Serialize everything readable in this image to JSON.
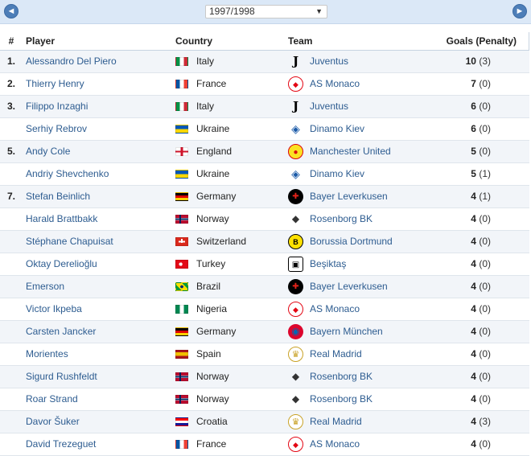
{
  "header": {
    "season": "1997/1998",
    "prev_glyph": "◄",
    "next_glyph": "►",
    "dropdown_glyph": "▼"
  },
  "columns": {
    "rank": "#",
    "player": "Player",
    "country": "Country",
    "team": "Team",
    "goals": "Goals (Penalty)"
  },
  "rows": [
    {
      "rank": "1.",
      "player": "Alessandro Del Piero",
      "country": "Italy",
      "flag": "italy",
      "team": "Juventus",
      "crest": "juventus",
      "goals": "10",
      "penalty": "(3)"
    },
    {
      "rank": "2.",
      "player": "Thierry Henry",
      "country": "France",
      "flag": "france",
      "team": "AS Monaco",
      "crest": "monaco",
      "goals": "7",
      "penalty": "(0)"
    },
    {
      "rank": "3.",
      "player": "Filippo Inzaghi",
      "country": "Italy",
      "flag": "italy",
      "team": "Juventus",
      "crest": "juventus",
      "goals": "6",
      "penalty": "(0)"
    },
    {
      "rank": "",
      "player": "Serhiy Rebrov",
      "country": "Ukraine",
      "flag": "ukraine",
      "team": "Dinamo Kiev",
      "crest": "dinamo",
      "goals": "6",
      "penalty": "(0)"
    },
    {
      "rank": "5.",
      "player": "Andy Cole",
      "country": "England",
      "flag": "england",
      "team": "Manchester United",
      "crest": "manutd",
      "goals": "5",
      "penalty": "(0)"
    },
    {
      "rank": "",
      "player": "Andriy Shevchenko",
      "country": "Ukraine",
      "flag": "ukraine",
      "team": "Dinamo Kiev",
      "crest": "dinamo",
      "goals": "5",
      "penalty": "(1)"
    },
    {
      "rank": "7.",
      "player": "Stefan Beinlich",
      "country": "Germany",
      "flag": "germany",
      "team": "Bayer Leverkusen",
      "crest": "leverkusen",
      "goals": "4",
      "penalty": "(1)"
    },
    {
      "rank": "",
      "player": "Harald Brattbakk",
      "country": "Norway",
      "flag": "norway",
      "team": "Rosenborg BK",
      "crest": "rosenborg",
      "goals": "4",
      "penalty": "(0)"
    },
    {
      "rank": "",
      "player": "Stéphane Chapuisat",
      "country": "Switzerland",
      "flag": "switzerland",
      "team": "Borussia Dortmund",
      "crest": "dortmund",
      "goals": "4",
      "penalty": "(0)"
    },
    {
      "rank": "",
      "player": "Oktay Derelioğlu",
      "country": "Turkey",
      "flag": "turkey",
      "team": "Beşiktaş",
      "crest": "besiktas",
      "goals": "4",
      "penalty": "(0)"
    },
    {
      "rank": "",
      "player": "Emerson",
      "country": "Brazil",
      "flag": "brazil",
      "team": "Bayer Leverkusen",
      "crest": "leverkusen",
      "goals": "4",
      "penalty": "(0)"
    },
    {
      "rank": "",
      "player": "Victor Ikpeba",
      "country": "Nigeria",
      "flag": "nigeria",
      "team": "AS Monaco",
      "crest": "monaco",
      "goals": "4",
      "penalty": "(0)"
    },
    {
      "rank": "",
      "player": "Carsten Jancker",
      "country": "Germany",
      "flag": "germany",
      "team": "Bayern München",
      "crest": "bayern",
      "goals": "4",
      "penalty": "(0)"
    },
    {
      "rank": "",
      "player": "Morientes",
      "country": "Spain",
      "flag": "spain",
      "team": "Real Madrid",
      "crest": "realmadrid",
      "goals": "4",
      "penalty": "(0)"
    },
    {
      "rank": "",
      "player": "Sigurd Rushfeldt",
      "country": "Norway",
      "flag": "norway",
      "team": "Rosenborg BK",
      "crest": "rosenborg",
      "goals": "4",
      "penalty": "(0)"
    },
    {
      "rank": "",
      "player": "Roar Strand",
      "country": "Norway",
      "flag": "norway",
      "team": "Rosenborg BK",
      "crest": "rosenborg",
      "goals": "4",
      "penalty": "(0)"
    },
    {
      "rank": "",
      "player": "Davor Šuker",
      "country": "Croatia",
      "flag": "croatia",
      "team": "Real Madrid",
      "crest": "realmadrid",
      "goals": "4",
      "penalty": "(3)"
    },
    {
      "rank": "",
      "player": "David Trezeguet",
      "country": "France",
      "flag": "france",
      "team": "AS Monaco",
      "crest": "monaco",
      "goals": "4",
      "penalty": "(0)"
    }
  ]
}
